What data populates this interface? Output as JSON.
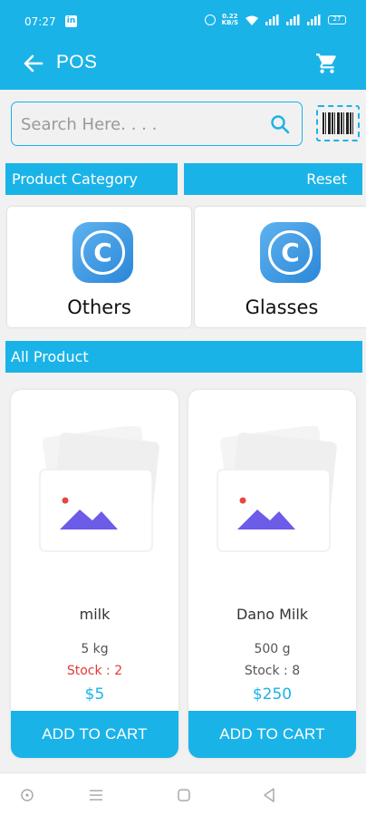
{
  "status_bar": {
    "time": "07:27",
    "app_icon": "linkedin-icon",
    "net_speed_top": "0.22",
    "net_speed_bottom": "KB/S",
    "battery": "27"
  },
  "app_bar": {
    "title": "POS",
    "back_icon": "arrow-left-icon",
    "cart_icon": "shopping-cart-icon"
  },
  "search": {
    "placeholder": "Search Here. . . .",
    "value": ""
  },
  "category_section": {
    "header": "Product Category",
    "reset_label": "Reset",
    "categories": [
      {
        "label": "Others",
        "icon": "copyright-icon"
      },
      {
        "label": "Glasses",
        "icon": "copyright-icon"
      }
    ]
  },
  "products_section": {
    "header": "All Product",
    "products": [
      {
        "name": "milk",
        "quantity": "5 kg",
        "stock": "Stock : 2",
        "price": "$5",
        "button": "ADD TO CART"
      },
      {
        "name": "Dano Milk",
        "quantity": "500 g",
        "stock": "Stock : 8",
        "price": "$250",
        "button": "ADD TO CART"
      }
    ]
  },
  "colors": {
    "accent": "#1ab3e8",
    "stock_low": "#e53935",
    "placeholder_purple": "#6c5ce7",
    "placeholder_red": "#e84545"
  }
}
